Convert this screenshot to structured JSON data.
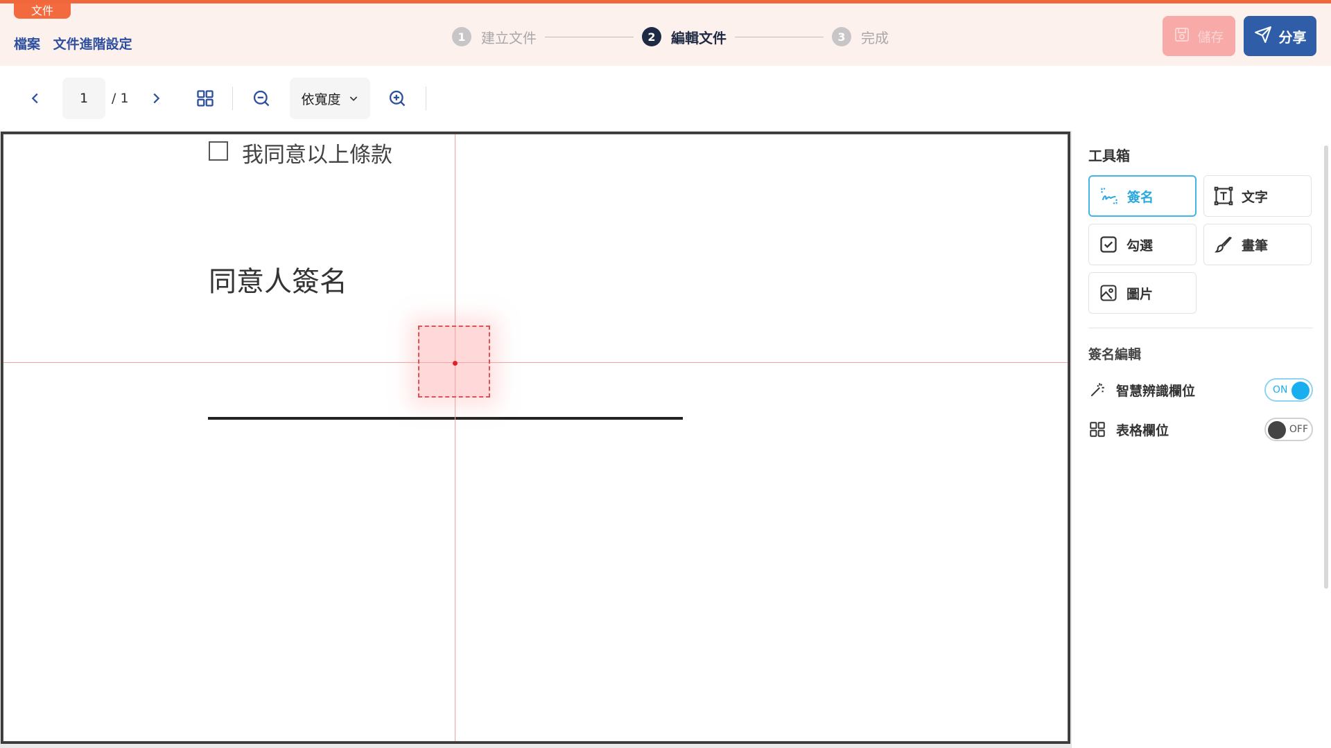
{
  "header": {
    "doc_tag": "文件",
    "links": [
      "檔案",
      "文件進階設定"
    ],
    "steps": [
      {
        "num": "1",
        "label": "建立文件",
        "state": "inactive"
      },
      {
        "num": "2",
        "label": "編輯文件",
        "state": "active"
      },
      {
        "num": "3",
        "label": "完成",
        "state": "inactive"
      }
    ],
    "save_label": "儲存",
    "share_label": "分享"
  },
  "toolbar": {
    "current_page": "1",
    "total_pages": "/ 1",
    "zoom_mode": "依寬度"
  },
  "document": {
    "agree_text": "我同意以上條款",
    "sign_title": "同意人簽名"
  },
  "panel": {
    "title": "工具箱",
    "tools": [
      "簽名",
      "文字",
      "勾選",
      "畫筆",
      "圖片"
    ],
    "section_title": "簽名編輯",
    "options": [
      {
        "label": "智慧辨識欄位",
        "toggle": "ON",
        "state": "on"
      },
      {
        "label": "表格欄位",
        "toggle": "OFF",
        "state": "off"
      }
    ]
  },
  "colors": {
    "accent_orange": "#f0673c",
    "step_active": "#1f2a44",
    "share_blue": "#2f5da8",
    "tool_selected": "#29a8e0"
  }
}
